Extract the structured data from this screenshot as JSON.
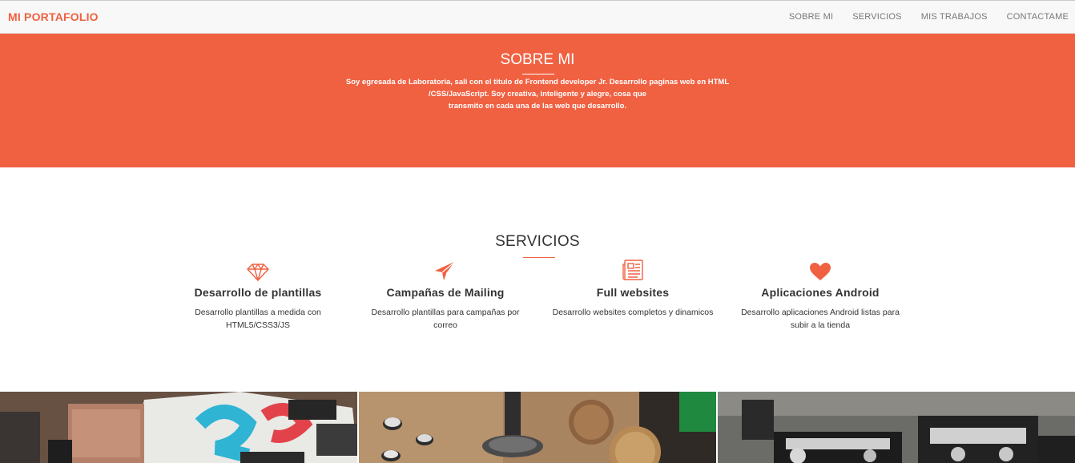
{
  "navbar": {
    "brand": "MI PORTAFOLIO",
    "links": [
      "SOBRE MI",
      "SERVICIOS",
      "MIS TRABAJOS",
      "CONTACTAME"
    ]
  },
  "about": {
    "title": "SOBRE MI",
    "lines": [
      "Soy egresada de Laboratoria, sali con el titulo de Frontend developer Jr. Desarrollo paginas web en HTML",
      "/CSS/JavaScript. Soy creativa, inteligente y alegre, cosa que",
      "transmito en cada una de las web que desarrollo."
    ]
  },
  "services": {
    "title": "SERVICIOS",
    "items": [
      {
        "icon": "diamond-icon",
        "title": "Desarrollo de plantillas",
        "lines": [
          "Desarrollo plantillas a medida con",
          "HTML5/CSS3/JS"
        ]
      },
      {
        "icon": "paper-plane-icon",
        "title": "Campañas de Mailing",
        "lines": [
          "Desarrollo plantillas para campañas por",
          "correo"
        ]
      },
      {
        "icon": "newspaper-icon",
        "title": "Full websites",
        "lines": [
          "Desarrollo websites completos y dinamicos"
        ]
      },
      {
        "icon": "heart-icon",
        "title": "Aplicaciones Android",
        "lines": [
          "Desarrollo aplicaciones Android listas para",
          "subir a la tienda"
        ]
      }
    ]
  },
  "colors": {
    "accent": "#f06142",
    "navbar_bg": "#f8f8f8"
  }
}
